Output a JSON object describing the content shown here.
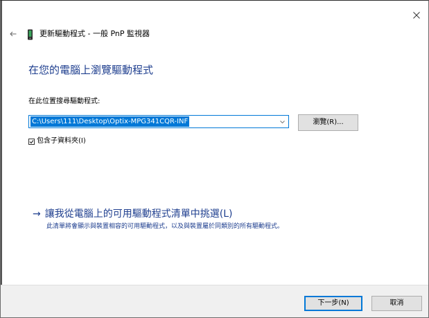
{
  "window": {
    "title": "更新驅動程式 - 一般 PnP 監視器"
  },
  "page": {
    "heading": "在您的電腦上瀏覽驅動程式"
  },
  "search": {
    "label": "在此位置搜尋驅動程式:",
    "path_value": "C:\\Users\\111\\Desktop\\Optix-MPG341CQR-INF",
    "browse_label": "瀏覽(R)...",
    "include_subfolders_label": "包含子資料夾(I)",
    "include_subfolders_checked": true
  },
  "pick_option": {
    "label": "讓我從電腦上的可用驅動程式清單中挑選(L)",
    "description": "此清單將會顯示與裝置相容的可用驅動程式，以及與裝置屬於同類別的所有驅動程式。"
  },
  "footer": {
    "next_label": "下一步(N)",
    "cancel_label": "取消"
  },
  "icons": {
    "close": "close-icon",
    "back": "back-arrow-icon",
    "device": "monitor-device-icon",
    "dropdown": "chevron-down-icon",
    "link_arrow": "right-arrow-icon"
  },
  "colors": {
    "accent": "#0078d7",
    "heading": "#1f3f8f",
    "footer_bg": "#f0f0f0",
    "button_bg": "#e1e1e1"
  }
}
